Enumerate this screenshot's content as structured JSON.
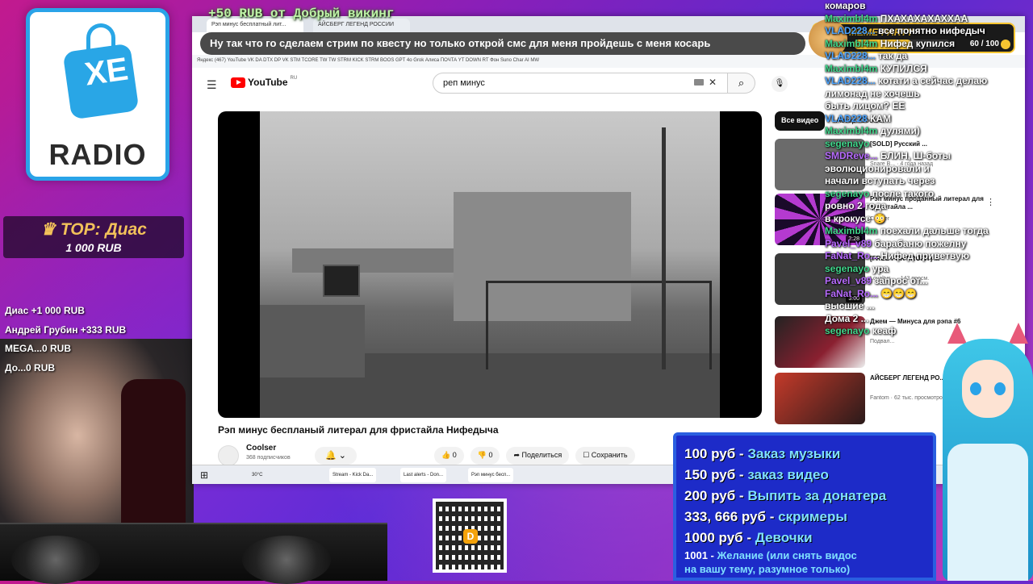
{
  "overlay": {
    "logo_text": "XE",
    "logo_sub": "RADIO",
    "top_donor_label": "TOP: Диас",
    "top_donor_amount": "1 000 RUB",
    "recent_donors": [
      "Диас +1 000 RUB",
      "Андрей Грубин +333 RUB",
      "MEGA...0 RUB",
      "До...0 RUB"
    ],
    "ticker_top": "+50 RUB  от  Добрый викинг",
    "ticker_message": "Ну так что го сделаем стрим по квесту но только открой смс для меня пройдешь с меня косарь"
  },
  "meme_party": {
    "title": "MEME-PARTY",
    "count": "60 / 100",
    "progress": 0.6
  },
  "browser": {
    "tabs": [
      "Рэп минус бесплатный лит...",
      "АЙСБЕРГ ЛЕГЕНД РОССИИ"
    ],
    "bookmarks": "Яндекс  (467) YouTube  VK  DA  DTX  DP  VK STM  TCORE  TW  TW STRM  KICK STRM  BOOS  GPT 4o  Grok  Алиса  ПОЧТА  YT DOWN  RT  Фон  Suno  Char AI  MW",
    "youtube": {
      "logo": "YouTube",
      "region": "RU",
      "search_query": "реп минус",
      "video_title": "Рэп минус беспланый литерал для фристайла Нифедыча",
      "channel": "Coolser",
      "subscribers": "368 подписчиков",
      "likes": "0",
      "dislikes": "0",
      "share": "Поделиться",
      "save": "Сохранить",
      "chip_all": "Все видео",
      "chip_author": "Автор: Coolser",
      "recommendations": [
        {
          "title": "[SOLD] Русский ...",
          "channel": "Snare B... · 4 года назад",
          "color": "#6b6b6b",
          "duration": ""
        },
        {
          "title": "Рэп минус проданный литерал для фристайла ...",
          "channel": "Coolser",
          "color": "#b43ad0",
          "duration": "2:28"
        },
        {
          "title": "[FREE FOR PROFIT] ...",
          "channel": "Loyaltys... · 143 просм.",
          "color": "#3a3a3a",
          "duration": "3:00"
        },
        {
          "title": "Джем — Минуса для рэпа #6",
          "channel": "Подвал...",
          "color": "#8a2030",
          "duration": ""
        },
        {
          "title": "АЙСБЕРГ ЛЕГЕНД РО...",
          "channel": "Fantom · 62 тыс. просмотров",
          "color": "#c43a2a",
          "duration": ""
        }
      ]
    },
    "taskbar": [
      "30°C",
      "Stream - Kick Da...",
      "Last alerts - Don...",
      "Рэп минус бесп..."
    ]
  },
  "chat": [
    {
      "name": "",
      "text": "комаров"
    },
    {
      "name": "Maximbl4m",
      "text": "ПХАХАХАХАХХАА"
    },
    {
      "name": "VLAD228...",
      "text": "все понятно нифедыч"
    },
    {
      "name": "Maximbl4m",
      "text": "Нифед купился"
    },
    {
      "name": "VLAD228...",
      "text": "так да"
    },
    {
      "name": "Maximbl4m",
      "text": "КУПИЛСЯ"
    },
    {
      "name": "VLAD228...",
      "text": "котати а сейчас делаю"
    },
    {
      "name": "",
      "text": "лимонад не хочешь"
    },
    {
      "name": "",
      "text": "быть лицом? EE"
    },
    {
      "name": "VLAD228",
      "text": "КАМ"
    },
    {
      "name": "Maximbl4m",
      "text": "дулями)"
    },
    {
      "name": "segenayo",
      "text": ""
    },
    {
      "name": "SMDReve...",
      "text": "БЛИН, Ш-боты"
    },
    {
      "name": "",
      "text": "эволюционировали и"
    },
    {
      "name": "",
      "text": "начали вступать через"
    },
    {
      "name": "segenayo",
      "text": "после такого"
    },
    {
      "name": "",
      "text": "ровно 2 года"
    },
    {
      "name": "",
      "text": "в крокусе 😳"
    },
    {
      "name": "",
      "text": ""
    },
    {
      "name": "Maximbl4m",
      "text": "поехали дальше тогда"
    },
    {
      "name": "Pavel_v89",
      "text": "барабаню пожелну"
    },
    {
      "name": "FaNat_Ro...",
      "text": "Нифед приветвую"
    },
    {
      "name": "segenayo",
      "text": "ура"
    },
    {
      "name": "Pavel_v89",
      "text": "запрос от..."
    },
    {
      "name": "FaNat_Ro...",
      "text": "😁😁😁"
    },
    {
      "name": "",
      "text": "высшие ..."
    },
    {
      "name": "",
      "text": "Дома 2 ..."
    },
    {
      "name": "segenayo",
      "text": "кеаф"
    }
  ],
  "prices": [
    {
      "amount": "100 руб",
      "desc": "Заказ музыки"
    },
    {
      "amount": "150 руб",
      "desc": "заказ видео"
    },
    {
      "amount": "200 руб",
      "desc": "Выпить за донатера"
    },
    {
      "amount": "333, 666 руб",
      "desc": "скримеры"
    },
    {
      "amount": "1000 руб",
      "desc": "Девочки"
    }
  ],
  "price_wish": {
    "amount": "1001",
    "desc": "Желание (или снять видос",
    "desc2": "на вашу тему, разумное только)"
  },
  "qr_badge": "D",
  "colors": {
    "accent": "#2aa3e8",
    "youtube_red": "#ff0000",
    "price_bg": "#1d2bc8",
    "meme_gold": "#f7c531"
  },
  "icons": {
    "search": "search-icon",
    "mic": "mic-icon",
    "bell": "bell-icon",
    "like": "thumbs-up-icon",
    "dislike": "thumbs-down-icon",
    "share": "share-icon",
    "save": "bookmark-icon",
    "menu": "hamburger-icon",
    "crown": "crown-icon"
  }
}
